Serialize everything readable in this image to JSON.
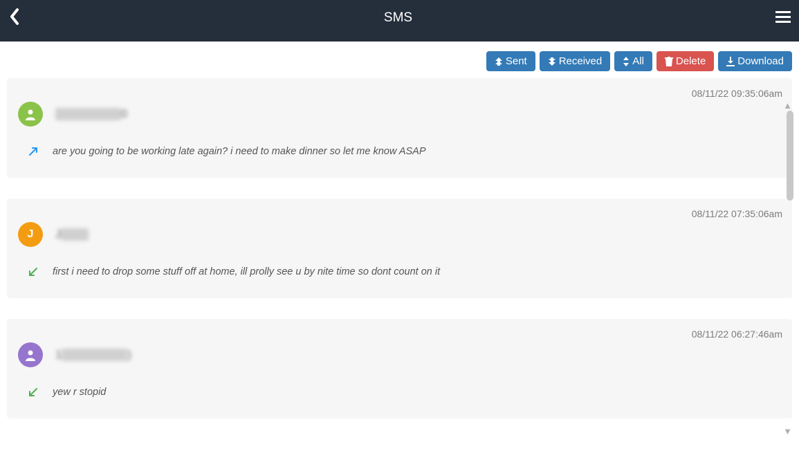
{
  "header": {
    "title": "SMS"
  },
  "filters": {
    "sent": "Sent",
    "received": "Received",
    "all": "All",
    "delete": "Delete",
    "download": "Download"
  },
  "messages": [
    {
      "timestamp": "08/11/22 09:35:06am",
      "avatar_color": "#8bc34a",
      "avatar_type": "icon",
      "avatar_letter": "",
      "sender_display": "█████████0",
      "direction": "sent",
      "body": "are you going to be working late again? i need to make dinner so let me know ASAP"
    },
    {
      "timestamp": "08/11/22 07:35:06am",
      "avatar_color": "#f39c12",
      "avatar_type": "letter",
      "avatar_letter": "J",
      "sender_display": "J███",
      "direction": "received",
      "body": "first i need to drop some stuff off at home, ill prolly see u by nite time so dont count on it"
    },
    {
      "timestamp": "08/11/22 06:27:46am",
      "avatar_color": "#9575cd",
      "avatar_type": "icon",
      "avatar_letter": "",
      "sender_display": "1█████████)",
      "direction": "received",
      "body": "yew r stopid"
    }
  ]
}
